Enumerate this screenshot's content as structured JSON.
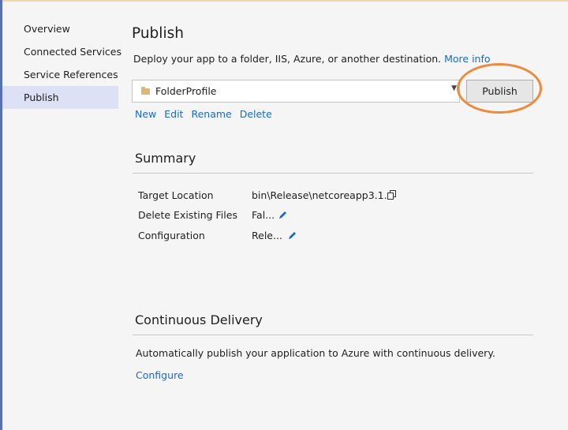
{
  "nav": {
    "items": [
      {
        "label": "Overview"
      },
      {
        "label": "Connected Services"
      },
      {
        "label": "Service References"
      },
      {
        "label": "Publish"
      }
    ]
  },
  "publish": {
    "title": "Publish",
    "description": "Deploy your app to a folder, IIS, Azure, or another destination.",
    "more_info_label": "More info",
    "profile_name": "FolderProfile",
    "publish_button_label": "Publish",
    "actions": {
      "new_label": "New",
      "edit_label": "Edit",
      "rename_label": "Rename",
      "delete_label": "Delete"
    }
  },
  "summary": {
    "title": "Summary",
    "rows": [
      {
        "label": "Target Location",
        "value": "bin\\Release\\netcoreapp3.1..."
      },
      {
        "label": "Delete Existing Files",
        "value": "Fal..."
      },
      {
        "label": "Configuration",
        "value": "Rele..."
      }
    ]
  },
  "continuous_delivery": {
    "title": "Continuous Delivery",
    "description": "Automatically publish your application to Azure with continuous delivery.",
    "configure_label": "Configure"
  },
  "colors": {
    "accent_link": "#1b6ac9",
    "selected_nav": "#dde1f5",
    "highlight": "#ee8a3b"
  },
  "icons": [
    "folder-icon",
    "chevron-down-icon",
    "copy-icon",
    "pencil-icon"
  ]
}
